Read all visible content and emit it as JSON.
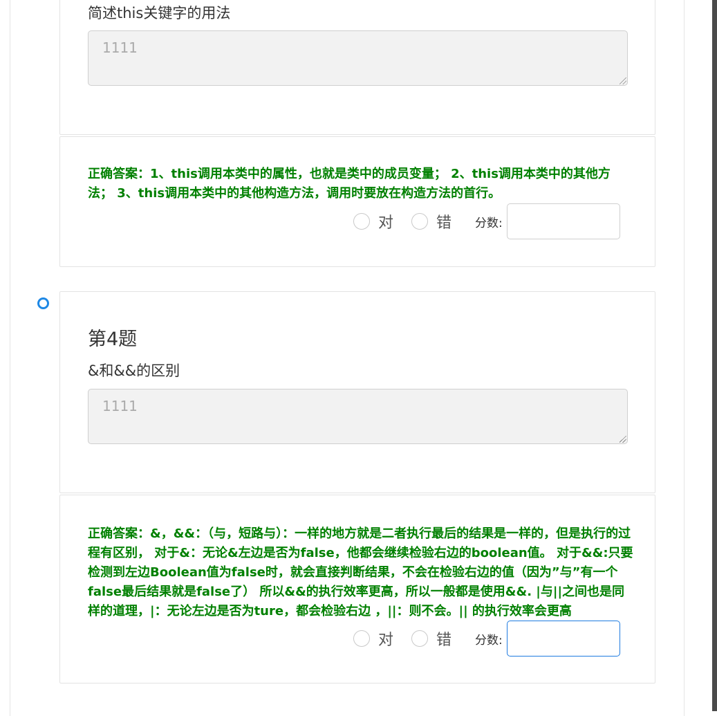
{
  "q3": {
    "question": "简述this关键字的用法",
    "answer_value": "1111",
    "correct_answer": "正确答案：1、this调用本类中的属性，也就是类中的成员变量； 2、this调用本类中的其他方法； 3、this调用本类中的其他构造方法，调用时要放在构造方法的首行。"
  },
  "q4": {
    "title": "第4题",
    "question": "&和&&的区别",
    "answer_value": "1111",
    "correct_answer": "正确答案：&，&&：（与，短路与）：一样的地方就是二者执行最后的结果是一样的，但是执行的过程有区别， 对于&：无论&左边是否为false，他都会继续检验右边的boolean值。 对于&&:只要检测到左边Boolean值为false时，就会直接判断结果，不会在检验右边的值（因为”与”有一个false最后结果就是false了） 所以&&的执行效率更高，所以一般都是使用&&. |与||之间也是同样的道理，|：无论左边是否为ture，都会检验右边 ，||：则不会。|| 的执行效率会更高"
  },
  "grading": {
    "right_label": "对",
    "wrong_label": "错",
    "score_label": "分数:"
  },
  "colors": {
    "correct_text": "#008000",
    "active_border": "#1e7be0",
    "marker": "#1e88e5"
  }
}
